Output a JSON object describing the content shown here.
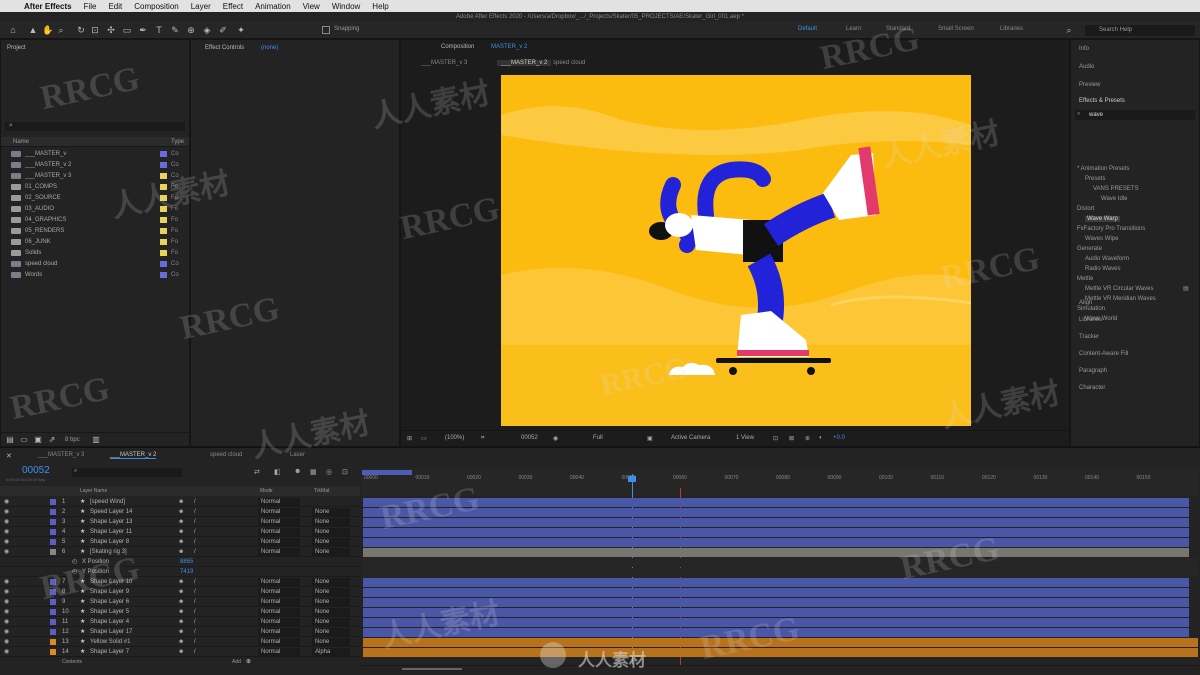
{
  "menubar": {
    "app_name": "After Effects",
    "items": [
      "File",
      "Edit",
      "Composition",
      "Layer",
      "Effect",
      "Animation",
      "View",
      "Window",
      "Help"
    ]
  },
  "titlebar": {
    "text": "Adobe After Effects 2020 - /Users/a/Dropbox/_.../_Projects/Skater/05_PROJECTS/AE/Skater_Girl_001.aep *"
  },
  "toolbar": {
    "snapping_label": "Snapping",
    "workspaces": [
      "Default",
      "Learn",
      "Standard",
      "Small Screen",
      "Libraries"
    ],
    "active_workspace": "Default",
    "search_placeholder": "Search Help"
  },
  "project": {
    "tab_label": "Project",
    "columns": {
      "name": "Name",
      "type": "Type"
    },
    "items": [
      {
        "name": "___MASTER_v",
        "type": "Co",
        "color": "#6a6adc"
      },
      {
        "name": "___MASTER_v 2",
        "type": "Co",
        "color": "#6a6adc"
      },
      {
        "name": "___MASTER_v 3",
        "type": "Co",
        "color": "#e8d35a"
      },
      {
        "name": "01_COMPS",
        "type": "Fo",
        "color": "#e8d35a"
      },
      {
        "name": "02_SOURCE",
        "type": "Fo",
        "color": "#e8d35a"
      },
      {
        "name": "03_AUDIO",
        "type": "Fo",
        "color": "#e8d35a"
      },
      {
        "name": "04_GRAPHICS",
        "type": "Fo",
        "color": "#e8d35a"
      },
      {
        "name": "05_RENDERS",
        "type": "Fo",
        "color": "#e8d35a"
      },
      {
        "name": "06_JUNK",
        "type": "Fo",
        "color": "#e8d35a"
      },
      {
        "name": "Solids",
        "type": "Fo",
        "color": "#e8d35a"
      },
      {
        "name": "speed cloud",
        "type": "Co",
        "color": "#6a6adc"
      },
      {
        "name": "Words",
        "type": "Co",
        "color": "#6a6adc"
      }
    ],
    "bpc_label": "8 bpc"
  },
  "effect_controls": {
    "tab_label": "Effect Controls",
    "layer_name": "(none)"
  },
  "composition": {
    "tab_label": "Composition",
    "comp_name": "MASTER_v 2",
    "nav_tabs": [
      "___MASTER_v 3",
      "___MASTER_v 2",
      "speed cloud"
    ],
    "zoom": "(100%)",
    "timecode": "00052",
    "resolution": "Full",
    "camera": "Active Camera",
    "views": "1 View",
    "offset": "+0.0"
  },
  "right_panel": {
    "items_top": [
      "Info",
      "Audio",
      "Preview"
    ],
    "effects_title": "Effects & Presets",
    "effects_search": "wave",
    "effects_tree": [
      {
        "label": "* Animation Presets",
        "indent": 0,
        "hl": false
      },
      {
        "label": "Presets",
        "indent": 1,
        "hl": false
      },
      {
        "label": "VANS PRESETS",
        "indent": 2,
        "hl": false
      },
      {
        "label": "Wave Idle",
        "indent": 3,
        "hl": false
      },
      {
        "label": "Distort",
        "indent": 0,
        "hl": false
      },
      {
        "label": "Wave Warp",
        "indent": 1,
        "hl": true
      },
      {
        "label": "FxFactory Pro Transitions",
        "indent": 0,
        "hl": false
      },
      {
        "label": "Waves Wipe",
        "indent": 1,
        "hl": false
      },
      {
        "label": "Generate",
        "indent": 0,
        "hl": false
      },
      {
        "label": "Audio Waveform",
        "indent": 1,
        "hl": false
      },
      {
        "label": "Radio Waves",
        "indent": 1,
        "hl": false
      },
      {
        "label": "Mettle",
        "indent": 0,
        "hl": false
      },
      {
        "label": "Mettle VR Circular Waves",
        "indent": 1,
        "hl": false
      },
      {
        "label": "Mettle VR Meridian Waves",
        "indent": 1,
        "hl": false
      },
      {
        "label": "Simulation",
        "indent": 0,
        "hl": false
      },
      {
        "label": "Wave World",
        "indent": 1,
        "hl": false
      }
    ],
    "items_bottom": [
      "Align",
      "Libraries",
      "Tracker",
      "Content-Aware Fill",
      "Paragraph",
      "Character"
    ]
  },
  "timeline": {
    "tabs": [
      "___MASTER_v 3",
      "___MASTER_v 2",
      "speed cloud",
      "Laser"
    ],
    "active_tab": "___MASTER_v 2",
    "timecode": "00052",
    "timecode_sub": "0:00:02:04 (25.00 fps)",
    "headers": {
      "source": "Layer Name",
      "mode": "Mode",
      "trkmat": "TrkMat"
    },
    "ruler": [
      "00000",
      "00010",
      "00020",
      "00030",
      "00040",
      "00050",
      "00060",
      "00070",
      "00080",
      "00090",
      "00100",
      "00110",
      "00120",
      "00130",
      "00140",
      "00150"
    ],
    "layers": [
      {
        "num": "1",
        "name": "[speed Wind]",
        "mode": "Normal",
        "trk": "",
        "color": "#5e5ec0"
      },
      {
        "num": "2",
        "name": "Speed Layer 14",
        "mode": "Normal",
        "trk": "None",
        "color": "#5e5ec0"
      },
      {
        "num": "3",
        "name": "Shape Layer 13",
        "mode": "Normal",
        "trk": "None",
        "color": "#5e5ec0"
      },
      {
        "num": "4",
        "name": "Shape Layer 11",
        "mode": "Normal",
        "trk": "None",
        "color": "#5e5ec0"
      },
      {
        "num": "5",
        "name": "Shape Layer 8",
        "mode": "Normal",
        "trk": "None",
        "color": "#5e5ec0"
      },
      {
        "num": "6",
        "name": "[Skating rig 3]",
        "mode": "Normal",
        "trk": "None",
        "color": "#888"
      },
      {
        "num": "",
        "name": "X Position",
        "mode": "",
        "trk": "",
        "color": "",
        "prop": "8865"
      },
      {
        "num": "",
        "name": "Y Position",
        "mode": "",
        "trk": "",
        "color": "",
        "prop": "7419"
      },
      {
        "num": "7",
        "name": "Shape Layer 10",
        "mode": "Normal",
        "trk": "None",
        "color": "#5e5ec0"
      },
      {
        "num": "8",
        "name": "Shape Layer 9",
        "mode": "Normal",
        "trk": "None",
        "color": "#5e5ec0"
      },
      {
        "num": "9",
        "name": "Shape Layer 6",
        "mode": "Normal",
        "trk": "None",
        "color": "#5e5ec0"
      },
      {
        "num": "10",
        "name": "Shape Layer 5",
        "mode": "Normal",
        "trk": "None",
        "color": "#5e5ec0"
      },
      {
        "num": "11",
        "name": "Shape Layer 4",
        "mode": "Normal",
        "trk": "None",
        "color": "#5e5ec0"
      },
      {
        "num": "12",
        "name": "Shape Layer 17",
        "mode": "Normal",
        "trk": "None",
        "color": "#5e5ec0"
      },
      {
        "num": "13",
        "name": "Yellow Solid #1",
        "mode": "Normal",
        "trk": "None",
        "color": "#e08a1e"
      },
      {
        "num": "14",
        "name": "Shape Layer 7",
        "mode": "Normal",
        "trk": "Alpha",
        "color": "#e08a1e"
      }
    ],
    "contents_label": "Contents",
    "add_label": "Add"
  },
  "watermark": {
    "text_latin": "RRCG",
    "text_cjk": "人人素材"
  },
  "colors": {
    "accent": "#3f8fe8",
    "canvas_bg": "#fbbc0f",
    "blue": "#2222d8",
    "pink": "#e23a6a"
  }
}
